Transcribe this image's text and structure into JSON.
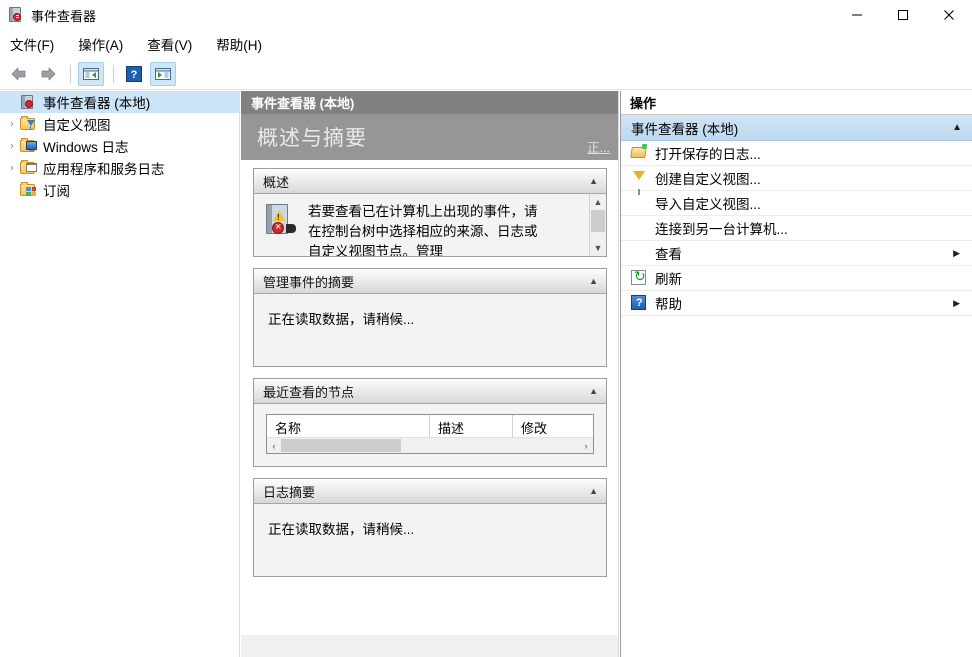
{
  "window": {
    "title": "事件查看器",
    "icon": "event-viewer-icon",
    "controls": {
      "minimize": "minimize-icon",
      "maximize": "maximize-icon",
      "close": "close-icon"
    }
  },
  "menubar": {
    "items": [
      {
        "label": "文件(F)",
        "name": "menu-file"
      },
      {
        "label": "操作(A)",
        "name": "menu-action"
      },
      {
        "label": "查看(V)",
        "name": "menu-view"
      },
      {
        "label": "帮助(H)",
        "name": "menu-help"
      }
    ]
  },
  "toolbar": {
    "buttons": [
      {
        "icon": "back-arrow-icon",
        "name": "toolbar-back"
      },
      {
        "icon": "forward-arrow-icon",
        "name": "toolbar-forward"
      },
      {
        "icon": "show-hide-tree-icon",
        "name": "toolbar-show-hide-console-tree"
      },
      {
        "icon": "help-icon",
        "name": "toolbar-help"
      },
      {
        "icon": "show-hide-action-pane-icon",
        "name": "toolbar-show-hide-action-pane"
      }
    ]
  },
  "tree": {
    "items": [
      {
        "label": "事件查看器 (本地)",
        "icon": "event-viewer-icon",
        "expandable": false,
        "selected": true,
        "indent": 0
      },
      {
        "label": "自定义视图",
        "icon": "custom-views-folder-icon",
        "expandable": true,
        "selected": false,
        "indent": 1
      },
      {
        "label": "Windows 日志",
        "icon": "windows-logs-folder-icon",
        "expandable": true,
        "selected": false,
        "indent": 1
      },
      {
        "label": "应用程序和服务日志",
        "icon": "app-service-logs-folder-icon",
        "expandable": true,
        "selected": false,
        "indent": 1
      },
      {
        "label": "订阅",
        "icon": "subscriptions-folder-icon",
        "expandable": false,
        "selected": false,
        "indent": 1
      }
    ]
  },
  "center": {
    "header": "事件查看器 (本地)",
    "banner_title": "概述与摘要",
    "banner_link": "正...",
    "sections": [
      {
        "title": "概述",
        "type": "overview",
        "toggle": "collapse-arrow",
        "text": "若要查看已在计算机上出现的事件，请在控制台树中选择相应的来源、日志或自定义视图节点。管理"
      },
      {
        "title": "管理事件的摘要",
        "type": "loading",
        "toggle": "collapse-arrow",
        "text": "正在读取数据，请稍候..."
      },
      {
        "title": "最近查看的节点",
        "type": "table",
        "toggle": "collapse-arrow",
        "columns": [
          "名称",
          "描述",
          "修改"
        ],
        "rows": []
      },
      {
        "title": "日志摘要",
        "type": "loading",
        "toggle": "collapse-arrow",
        "text": "正在读取数据，请稍候..."
      }
    ]
  },
  "actions": {
    "header": "操作",
    "group": {
      "title": "事件查看器 (本地)",
      "toggle": "collapse-arrow"
    },
    "items": [
      {
        "label": "打开保存的日志...",
        "icon": "open-folder-icon",
        "submenu": false
      },
      {
        "label": "创建自定义视图...",
        "icon": "funnel-icon",
        "submenu": false
      },
      {
        "label": "导入自定义视图...",
        "icon": "none",
        "submenu": false
      },
      {
        "label": "连接到另一台计算机...",
        "icon": "none",
        "submenu": false
      },
      {
        "label": "查看",
        "icon": "none",
        "submenu": true
      },
      {
        "label": "刷新",
        "icon": "refresh-icon",
        "submenu": false
      },
      {
        "label": "帮助",
        "icon": "help-icon",
        "submenu": true
      }
    ]
  },
  "colors": {
    "selection_blue": "#cce4f7",
    "header_gray": "#808080",
    "banner_gray": "#969696",
    "action_group_blue": "#c6ddf0"
  }
}
